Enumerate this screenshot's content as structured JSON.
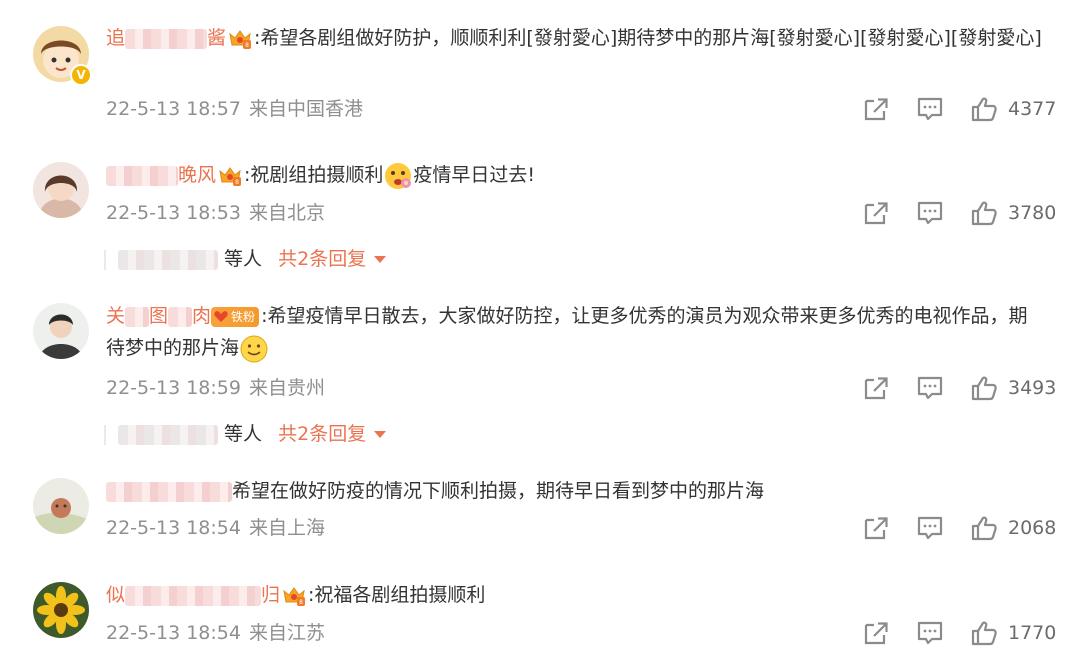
{
  "comments": [
    {
      "user_visible_start": "追",
      "user_visible_end": "酱",
      "text": ":希望各剧组做好防护，顺顺利利[發射愛心]期待梦中的那片海[發射愛心][發射愛心][發射愛心]",
      "time": "22-5-13 18:57",
      "source": "来自中国香港",
      "likes": "4377"
    },
    {
      "user_visible_end": "晚风",
      "text_before_emoji": ":祝剧组拍摄顺利",
      "text_after_emoji": "疫情早日过去!",
      "time": "22-5-13 18:53",
      "source": "来自北京",
      "likes": "3780",
      "replies_suffix": "等人",
      "replies_more": "共2条回复"
    },
    {
      "user_visible_start": "关",
      "user_visible_mid": "图",
      "user_visible_end": "肉",
      "fan_badge": "铁粉",
      "text": ":希望疫情早日散去，大家做好防控，让更多优秀的演员为观众带来更多优秀的电视作品，期待梦中的那片海",
      "time": "22-5-13 18:59",
      "source": "来自贵州",
      "likes": "3493",
      "replies_suffix": "等人",
      "replies_more": "共2条回复"
    },
    {
      "text": "希望在做好防疫的情况下顺利拍摄，期待早日看到梦中的那片海",
      "time": "22-5-13 18:54",
      "source": "来自上海",
      "likes": "2068"
    },
    {
      "user_visible_start": "似",
      "user_visible_end": "归",
      "text": ":祝福各剧组拍摄顺利",
      "time": "22-5-13 18:54",
      "source": "来自江苏",
      "likes": "1770"
    }
  ],
  "icons": {
    "share": "share-icon",
    "comment": "comment-icon",
    "like": "thumbs-up-icon",
    "crown": "vip-crown-icon",
    "verified": "verified-v-icon"
  },
  "colors": {
    "accent": "#eb7350",
    "meta": "#8f8f8f",
    "text": "#333333",
    "icon": "#8b8b8b"
  }
}
